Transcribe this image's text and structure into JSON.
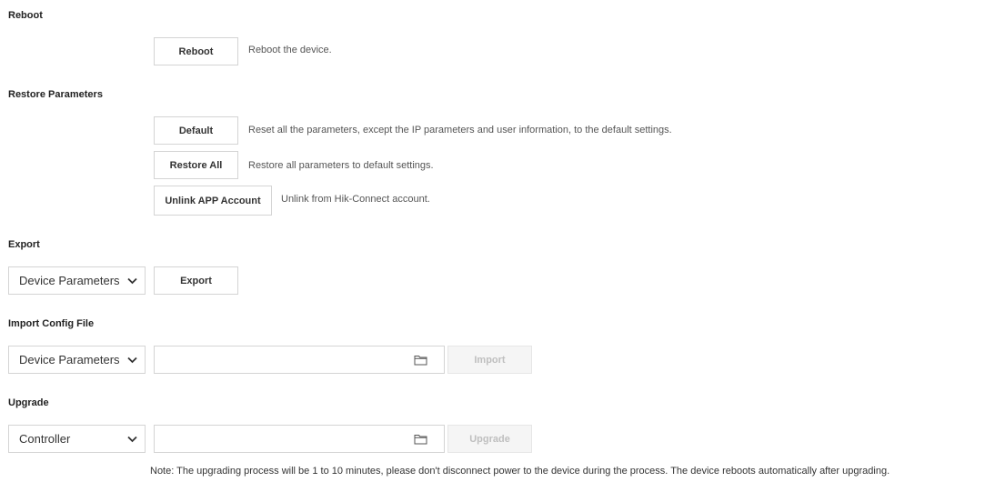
{
  "reboot": {
    "heading": "Reboot",
    "button_label": "Reboot",
    "description": "Reboot the device."
  },
  "restore": {
    "heading": "Restore Parameters",
    "default_label": "Default",
    "default_description": "Reset all the parameters, except the IP parameters and user information, to the default settings.",
    "restore_all_label": "Restore All",
    "restore_all_description": "Restore all parameters to default settings.",
    "unlink_label": "Unlink APP Account",
    "unlink_description": "Unlink from Hik-Connect account."
  },
  "export": {
    "heading": "Export",
    "selected": "Device Parameters",
    "button_label": "Export"
  },
  "import": {
    "heading": "Import Config File",
    "selected": "Device Parameters",
    "file_value": "",
    "button_label": "Import"
  },
  "upgrade": {
    "heading": "Upgrade",
    "selected": "Controller",
    "file_value": "",
    "button_label": "Upgrade",
    "note": "Note: The upgrading process will be 1 to 10 minutes, please don't disconnect power to the device during the process. The device reboots automatically after upgrading."
  },
  "icons": {
    "dropdown": "chevron-down-icon",
    "file_browse": "folder-icon"
  },
  "colors": {
    "border": "#d4d4d4",
    "disabled_text": "#bfbfbf",
    "heading_text": "#222222"
  }
}
